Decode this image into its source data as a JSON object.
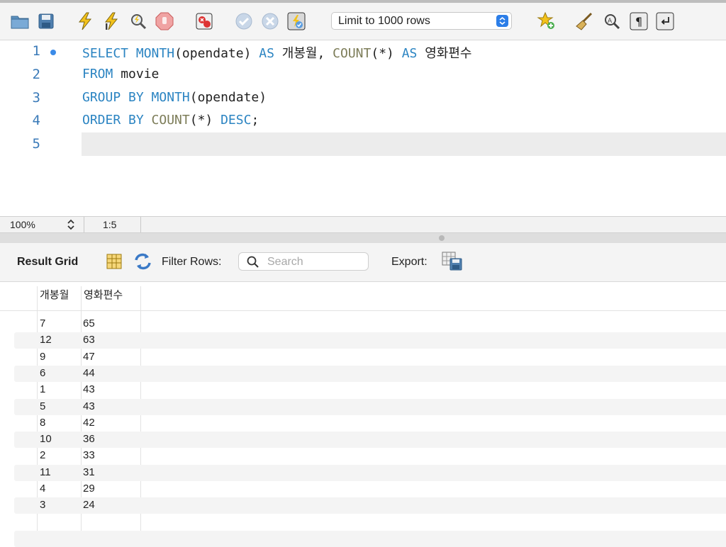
{
  "toolbar": {
    "icons": [
      "folder-icon",
      "save-icon",
      "execute-icon",
      "execute-current-icon",
      "explain-icon",
      "stop-icon",
      "stop-on-error-icon",
      "commit-icon",
      "rollback-icon",
      "autocommit-icon",
      "favorite-add-icon",
      "beautify-icon",
      "find-icon",
      "invisible-chars-icon",
      "wrap-icon"
    ],
    "limit_label": "Limit to 1000 rows"
  },
  "editor": {
    "line_numbers": [
      "1",
      "2",
      "3",
      "4",
      "5"
    ],
    "lines": [
      [
        {
          "t": "SELECT",
          "c": "kw"
        },
        {
          "t": " ",
          "c": ""
        },
        {
          "t": "MONTH",
          "c": "kw"
        },
        {
          "t": "(opendate) ",
          "c": ""
        },
        {
          "t": "AS",
          "c": "kw"
        },
        {
          "t": " 개봉월, ",
          "c": ""
        },
        {
          "t": "COUNT",
          "c": "fn"
        },
        {
          "t": "(*) ",
          "c": ""
        },
        {
          "t": "AS",
          "c": "kw"
        },
        {
          "t": " 영화편수",
          "c": ""
        }
      ],
      [
        {
          "t": "FROM",
          "c": "kw"
        },
        {
          "t": " movie",
          "c": ""
        }
      ],
      [
        {
          "t": "GROUP BY",
          "c": "kw"
        },
        {
          "t": " ",
          "c": ""
        },
        {
          "t": "MONTH",
          "c": "kw"
        },
        {
          "t": "(opendate)",
          "c": ""
        }
      ],
      [
        {
          "t": "ORDER BY",
          "c": "kw"
        },
        {
          "t": " ",
          "c": ""
        },
        {
          "t": "COUNT",
          "c": "fn"
        },
        {
          "t": "(*) ",
          "c": ""
        },
        {
          "t": "DESC",
          "c": "kw"
        },
        {
          "t": ";",
          "c": ""
        }
      ],
      []
    ]
  },
  "status": {
    "zoom": "100%",
    "position": "1:5"
  },
  "results": {
    "title": "Result Grid",
    "filter_label": "Filter Rows:",
    "search_placeholder": "Search",
    "export_label": "Export:",
    "columns": [
      "개봉월",
      "영화편수"
    ],
    "rows": [
      [
        "7",
        "65"
      ],
      [
        "12",
        "63"
      ],
      [
        "9",
        "47"
      ],
      [
        "6",
        "44"
      ],
      [
        "1",
        "43"
      ],
      [
        "5",
        "43"
      ],
      [
        "8",
        "42"
      ],
      [
        "10",
        "36"
      ],
      [
        "2",
        "33"
      ],
      [
        "11",
        "31"
      ],
      [
        "4",
        "29"
      ],
      [
        "3",
        "24"
      ]
    ]
  }
}
